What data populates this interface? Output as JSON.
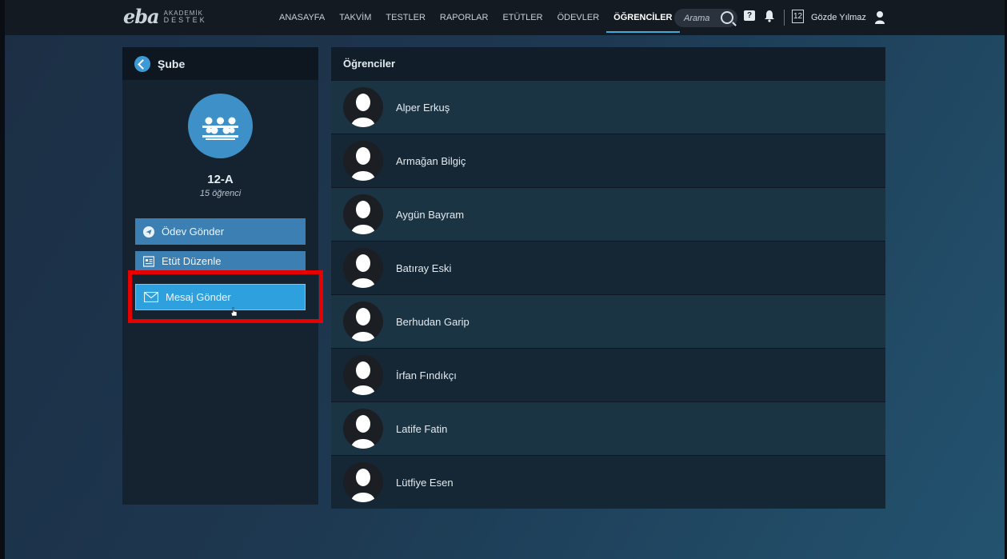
{
  "header": {
    "logo_main": "eba",
    "logo_top": "AKADEMİK",
    "logo_bottom": "DESTEK",
    "nav": [
      {
        "label": "ANASAYFA",
        "active": false
      },
      {
        "label": "TAKVİM",
        "active": false
      },
      {
        "label": "TESTLER",
        "active": false
      },
      {
        "label": "RAPORLAR",
        "active": false
      },
      {
        "label": "ETÜTLER",
        "active": false
      },
      {
        "label": "ÖDEVLER",
        "active": false
      },
      {
        "label": "ÖĞRENCİLER",
        "active": true
      }
    ],
    "search_placeholder": "Arama",
    "help_glyph": "?",
    "calendar_day": "12",
    "user_name": "Gözde Yılmaz"
  },
  "sidebar": {
    "title": "Şube",
    "class_name": "12-A",
    "student_count": "15 öğrenci",
    "actions": {
      "send_homework": "Ödev Gönder",
      "edit_study": "Etüt Düzenle",
      "send_message": "Mesaj Gönder"
    }
  },
  "students": {
    "title": "Öğrenciler",
    "list": [
      "Alper Erkuş",
      "Armağan Bilgiç",
      "Aygün Bayram",
      "Batıray Eski",
      "Berhudan Garip",
      "İrfan Fındıkçı",
      "Latife Fatin",
      "Lütfiye Esen"
    ]
  },
  "colors": {
    "accent": "#2da0dd",
    "button": "#3c7fb3",
    "highlight": "#e60000"
  }
}
